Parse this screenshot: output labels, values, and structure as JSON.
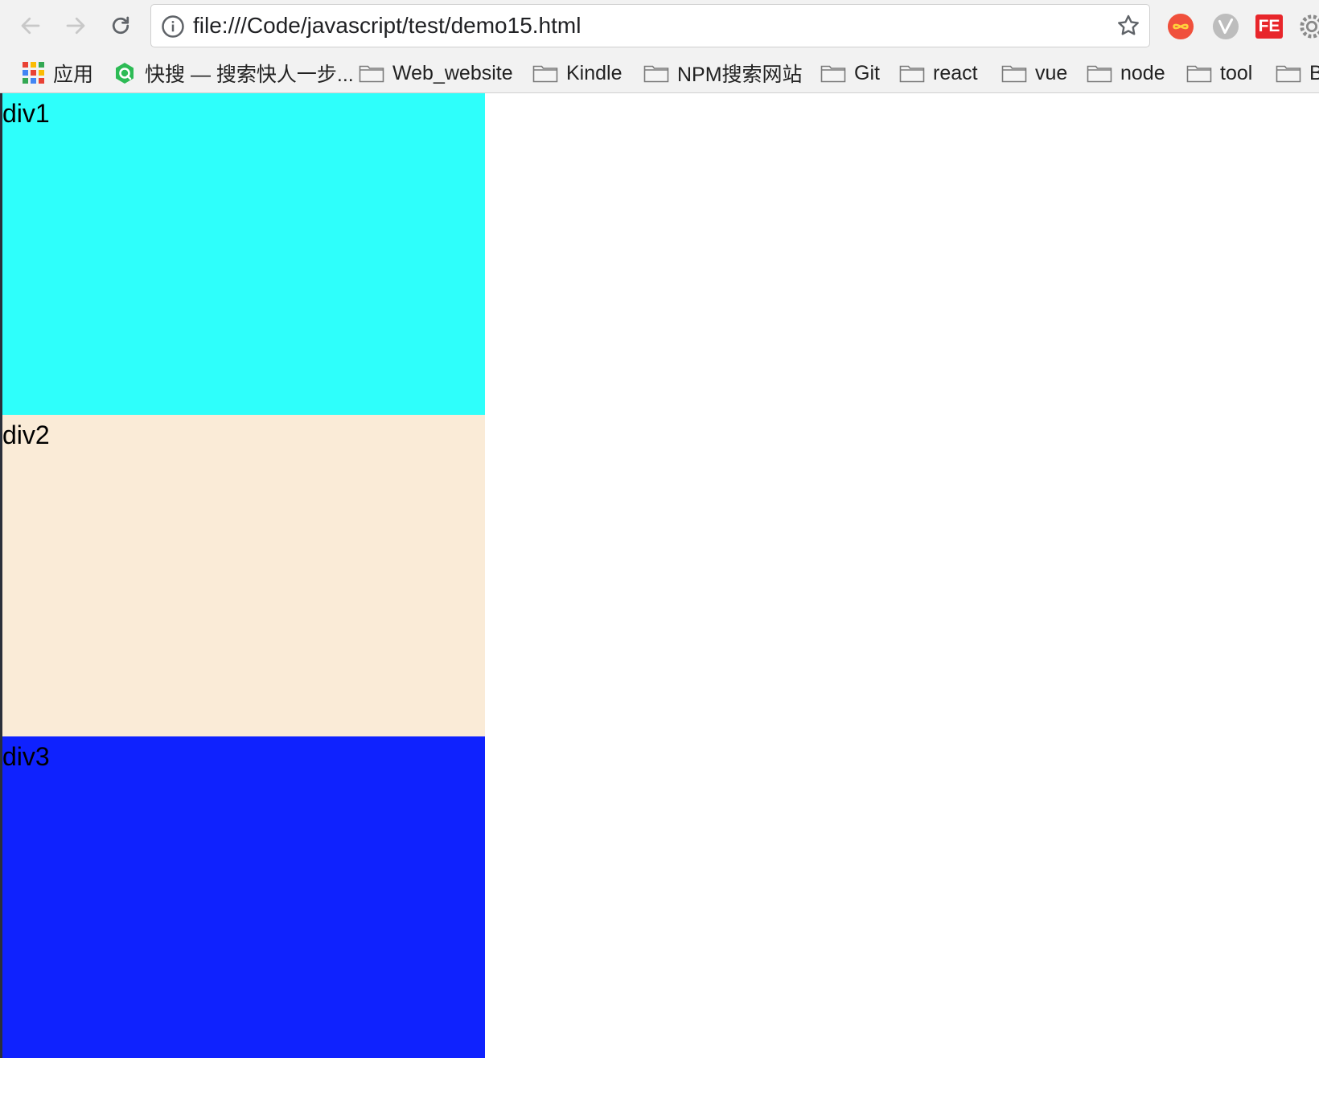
{
  "toolbar": {
    "url": "file:///Code/javascript/test/demo15.html",
    "icons": [
      "back-arrow-icon",
      "forward-arrow-icon",
      "reload-icon",
      "info-icon",
      "star-icon"
    ],
    "extensions": [
      "infinity-extension-icon",
      "v-extension-icon",
      "fe-extension-icon",
      "gear-extension-icon"
    ],
    "fe_label": "FE"
  },
  "bookmarks": {
    "apps_label": "应用",
    "items": [
      {
        "label": "快搜 — 搜索快人一步...",
        "icon": "kuaisou-icon"
      },
      {
        "label": "Web_website",
        "icon": "folder-icon"
      },
      {
        "label": "Kindle",
        "icon": "folder-icon"
      },
      {
        "label": "NPM搜索网站",
        "icon": "folder-icon"
      },
      {
        "label": "Git",
        "icon": "folder-icon"
      },
      {
        "label": "react",
        "icon": "folder-icon"
      },
      {
        "label": "vue",
        "icon": "folder-icon"
      },
      {
        "label": "node",
        "icon": "folder-icon"
      },
      {
        "label": "tool",
        "icon": "folder-icon"
      },
      {
        "label": "B",
        "icon": "folder-icon"
      }
    ]
  },
  "page": {
    "divs": [
      {
        "label": "div1",
        "color": "#2efffb"
      },
      {
        "label": "div2",
        "color": "#faebd7"
      },
      {
        "label": "div3",
        "color": "#0f22fe"
      }
    ]
  }
}
